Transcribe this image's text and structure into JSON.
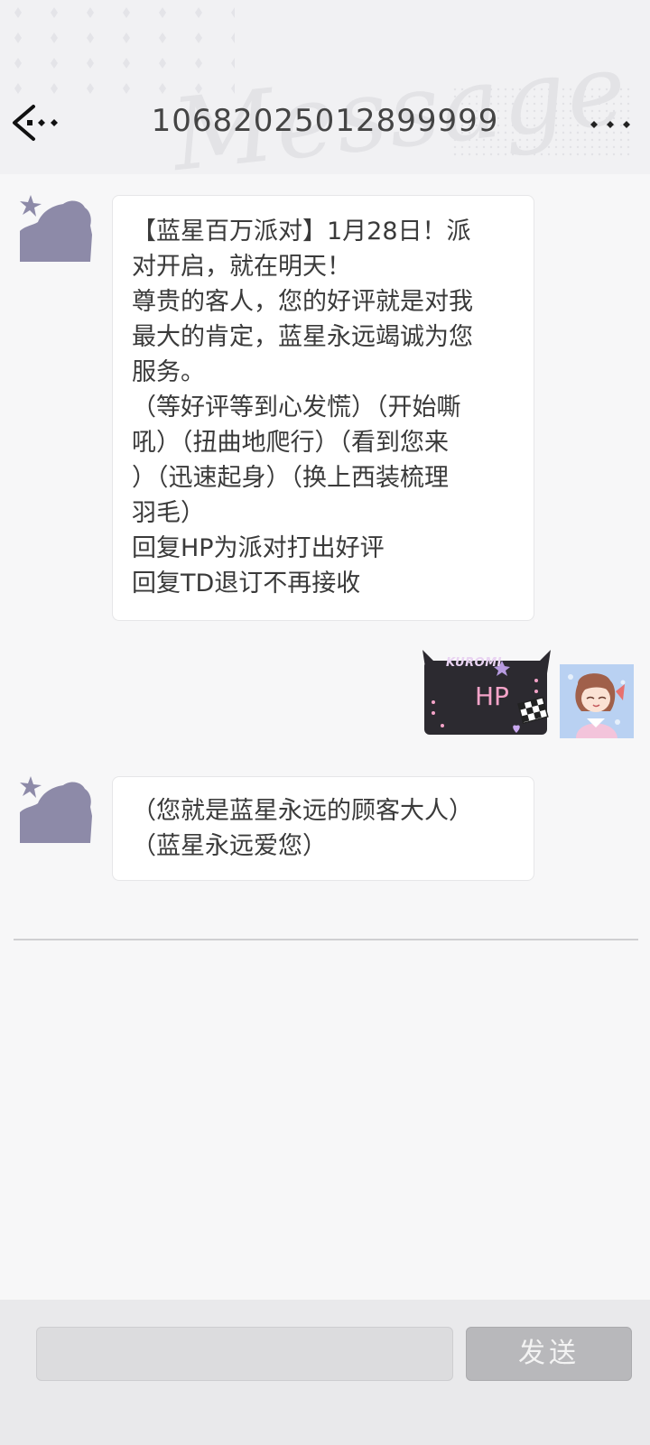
{
  "header": {
    "title": "10682025012899999",
    "back_icon": "back-arrow-icon",
    "more_icon": "more-dots-icon"
  },
  "messages": [
    {
      "sender": "contact",
      "lines": [
        "【蓝星百万派对】1月28日！派",
        "对开启，就在明天！",
        "尊贵的客人，您的好评就是对我",
        "最大的肯定，蓝星永远竭诚为您",
        "服务。",
        "（等好评等到心发慌）（开始嘶",
        "吼）（扭曲地爬行）（看到您来",
        "）（迅速起身）（换上西装梳理",
        "羽毛）",
        "回复HP为派对打出好评",
        "回复TD退订不再接收"
      ]
    },
    {
      "sender": "me",
      "sticker_brand": "KUROMI",
      "sticker_text": "HP"
    },
    {
      "sender": "contact",
      "lines": [
        "（您就是蓝星永远的顾客大人）",
        "（蓝星永远爱您）"
      ]
    }
  ],
  "composer": {
    "input_value": "",
    "send_label": "发送"
  },
  "colors": {
    "avatar_silhouette": "#8d8aa8",
    "sticker_pink": "#f4a3c8",
    "send_button": "#b8b8bb"
  }
}
